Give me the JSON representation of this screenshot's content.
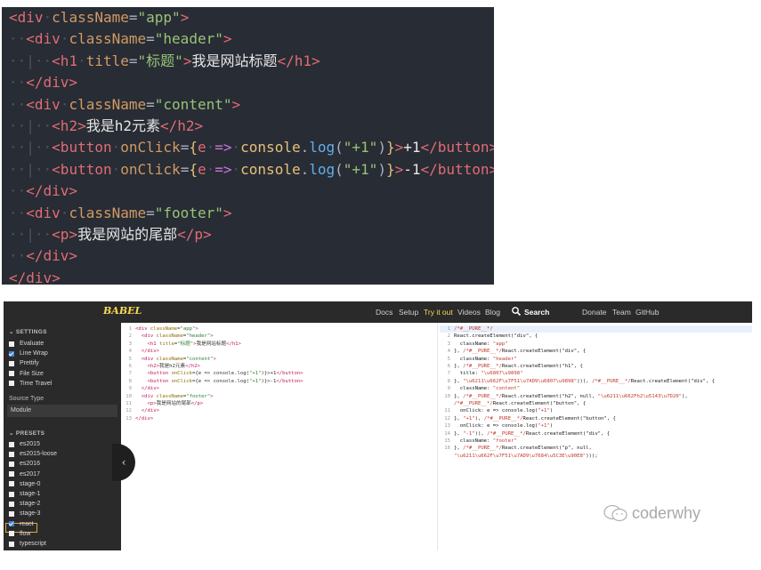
{
  "top_code": {
    "lines": [
      {
        "ind": "",
        "parts": [
          [
            "tag",
            "<div"
          ],
          [
            "ind",
            "·"
          ],
          [
            "attr",
            "className"
          ],
          [
            "punc",
            "="
          ],
          [
            "str",
            "\"app\""
          ],
          [
            "tag",
            ">"
          ]
        ]
      },
      {
        "ind": "··",
        "parts": [
          [
            "tag",
            "<div"
          ],
          [
            "ind",
            "·"
          ],
          [
            "attr",
            "className"
          ],
          [
            "punc",
            "="
          ],
          [
            "str",
            "\"header\""
          ],
          [
            "tag",
            ">"
          ]
        ]
      },
      {
        "ind": "··|··",
        "parts": [
          [
            "tag",
            "<h1"
          ],
          [
            "ind",
            "·"
          ],
          [
            "attr",
            "title"
          ],
          [
            "punc",
            "="
          ],
          [
            "str",
            "\"标题\""
          ],
          [
            "tag",
            ">"
          ],
          [
            "txt",
            "我是网站标题"
          ],
          [
            "tag",
            "</h1>"
          ]
        ]
      },
      {
        "ind": "··",
        "parts": [
          [
            "tag",
            "</div>"
          ]
        ]
      },
      {
        "ind": "··",
        "parts": [
          [
            "tag",
            "<div"
          ],
          [
            "ind",
            "·"
          ],
          [
            "attr",
            "className"
          ],
          [
            "punc",
            "="
          ],
          [
            "str",
            "\"content\""
          ],
          [
            "tag",
            ">"
          ]
        ]
      },
      {
        "ind": "··|··",
        "parts": [
          [
            "tag",
            "<h2"
          ],
          [
            "tag",
            ">"
          ],
          [
            "txt",
            "我是h2元素"
          ],
          [
            "tag",
            "</h2>"
          ]
        ]
      },
      {
        "ind": "··|··",
        "parts": [
          [
            "tag",
            "<button"
          ],
          [
            "ind",
            "·"
          ],
          [
            "attr",
            "onClick"
          ],
          [
            "punc",
            "="
          ],
          [
            "brace",
            "{"
          ],
          [
            "param",
            "e"
          ],
          [
            "ind",
            "·"
          ],
          [
            "arrow",
            "=>"
          ],
          [
            "ind",
            "·"
          ],
          [
            "ident",
            "console"
          ],
          [
            "punc",
            "."
          ],
          [
            "func",
            "log"
          ],
          [
            "punc",
            "("
          ],
          [
            "str",
            "\"+1\""
          ],
          [
            "punc",
            ")"
          ],
          [
            "brace",
            "}"
          ],
          [
            "tag",
            ">"
          ],
          [
            "txt",
            "+1"
          ],
          [
            "tag",
            "</button>"
          ]
        ]
      },
      {
        "ind": "··|··",
        "parts": [
          [
            "tag",
            "<button"
          ],
          [
            "ind",
            "·"
          ],
          [
            "attr",
            "onClick"
          ],
          [
            "punc",
            "="
          ],
          [
            "brace",
            "{"
          ],
          [
            "param",
            "e"
          ],
          [
            "ind",
            "·"
          ],
          [
            "arrow",
            "=>"
          ],
          [
            "ind",
            "·"
          ],
          [
            "ident",
            "console"
          ],
          [
            "punc",
            "."
          ],
          [
            "func",
            "log"
          ],
          [
            "punc",
            "("
          ],
          [
            "str",
            "\"+1\""
          ],
          [
            "punc",
            ")"
          ],
          [
            "brace",
            "}"
          ],
          [
            "tag",
            ">"
          ],
          [
            "txt",
            "-1"
          ],
          [
            "tag",
            "</button>"
          ]
        ]
      },
      {
        "ind": "··",
        "parts": [
          [
            "tag",
            "</div>"
          ]
        ]
      },
      {
        "ind": "··",
        "parts": [
          [
            "tag",
            "<div"
          ],
          [
            "ind",
            "·"
          ],
          [
            "attr",
            "className"
          ],
          [
            "punc",
            "="
          ],
          [
            "str",
            "\"footer\""
          ],
          [
            "tag",
            ">"
          ]
        ]
      },
      {
        "ind": "··|··",
        "parts": [
          [
            "tag",
            "<p"
          ],
          [
            "tag",
            ">"
          ],
          [
            "txt",
            "我是网站的尾部"
          ],
          [
            "tag",
            "</p>"
          ]
        ]
      },
      {
        "ind": "··",
        "parts": [
          [
            "tag",
            "</div>"
          ]
        ]
      },
      {
        "ind": "",
        "parts": [
          [
            "tag",
            "</div>"
          ]
        ]
      }
    ]
  },
  "babel": {
    "logo": "BABEL",
    "nav": [
      {
        "label": "Docs",
        "active": false
      },
      {
        "label": "Setup",
        "active": false
      },
      {
        "label": "Try it out",
        "active": true
      },
      {
        "label": "Videos",
        "active": false
      },
      {
        "label": "Blog",
        "active": false
      },
      {
        "label": "Search",
        "active": false,
        "bold": true
      },
      {
        "label": "Donate",
        "active": false
      },
      {
        "label": "Team",
        "active": false
      },
      {
        "label": "GitHub",
        "active": false
      }
    ],
    "sidebar": {
      "settings_header": "SETTINGS",
      "settings": [
        {
          "label": "Evaluate",
          "checked": false
        },
        {
          "label": "Line Wrap",
          "checked": true
        },
        {
          "label": "Prettify",
          "checked": false
        },
        {
          "label": "File Size",
          "checked": false
        },
        {
          "label": "Time Travel",
          "checked": false
        }
      ],
      "source_type_label": "Source Type",
      "source_type_value": "Module",
      "presets_header": "PRESETS",
      "presets": [
        {
          "label": "es2015",
          "checked": false
        },
        {
          "label": "es2015-loose",
          "checked": false
        },
        {
          "label": "es2016",
          "checked": false
        },
        {
          "label": "es2017",
          "checked": false
        },
        {
          "label": "stage-0",
          "checked": false
        },
        {
          "label": "stage-1",
          "checked": false
        },
        {
          "label": "stage-2",
          "checked": false
        },
        {
          "label": "stage-3",
          "checked": false
        },
        {
          "label": "react",
          "checked": true
        },
        {
          "label": "flow",
          "checked": false
        },
        {
          "label": "typescript",
          "checked": false
        }
      ],
      "collapse_glyph": "‹"
    },
    "input_lines": [
      [
        [
          "b-tag",
          "<div "
        ],
        [
          "b-attr",
          "className"
        ],
        [
          "b-txt",
          "="
        ],
        [
          "b-str",
          "\"app\""
        ],
        [
          "b-tag",
          ">"
        ]
      ],
      [
        [
          "b-txt",
          "  "
        ],
        [
          "b-tag",
          "<div "
        ],
        [
          "b-attr",
          "className"
        ],
        [
          "b-txt",
          "="
        ],
        [
          "b-str",
          "\"header\""
        ],
        [
          "b-tag",
          ">"
        ]
      ],
      [
        [
          "b-txt",
          "    "
        ],
        [
          "b-tag",
          "<h1 "
        ],
        [
          "b-attr",
          "title"
        ],
        [
          "b-txt",
          "="
        ],
        [
          "b-str",
          "\"标题\""
        ],
        [
          "b-tag",
          ">"
        ],
        [
          "b-txt",
          "我是网站标题"
        ],
        [
          "b-tag",
          "</h1>"
        ]
      ],
      [
        [
          "b-txt",
          "  "
        ],
        [
          "b-tag",
          "</div>"
        ]
      ],
      [
        [
          "b-txt",
          "  "
        ],
        [
          "b-tag",
          "<div "
        ],
        [
          "b-attr",
          "className"
        ],
        [
          "b-txt",
          "="
        ],
        [
          "b-str",
          "\"content\""
        ],
        [
          "b-tag",
          ">"
        ]
      ],
      [
        [
          "b-txt",
          "    "
        ],
        [
          "b-tag",
          "<h2>"
        ],
        [
          "b-txt",
          "我是h2元素"
        ],
        [
          "b-tag",
          "</h2>"
        ]
      ],
      [
        [
          "b-txt",
          "    "
        ],
        [
          "b-tag",
          "<button "
        ],
        [
          "b-attr",
          "onClick"
        ],
        [
          "b-txt",
          "={e => console.log("
        ],
        [
          "b-str",
          "\"+1\""
        ],
        [
          "b-txt",
          ")}>+1"
        ],
        [
          "b-tag",
          "</button>"
        ]
      ],
      [
        [
          "b-txt",
          "    "
        ],
        [
          "b-tag",
          "<button "
        ],
        [
          "b-attr",
          "onClick"
        ],
        [
          "b-txt",
          "={e => console.log("
        ],
        [
          "b-str",
          "\"+1\""
        ],
        [
          "b-txt",
          ")}>-1"
        ],
        [
          "b-tag",
          "</button>"
        ]
      ],
      [
        [
          "b-txt",
          "  "
        ],
        [
          "b-tag",
          "</div>"
        ]
      ],
      [
        [
          "b-txt",
          "  "
        ],
        [
          "b-tag",
          "<div "
        ],
        [
          "b-attr",
          "className"
        ],
        [
          "b-txt",
          "="
        ],
        [
          "b-str",
          "\"footer\""
        ],
        [
          "b-tag",
          ">"
        ]
      ],
      [
        [
          "b-txt",
          "    "
        ],
        [
          "b-tag",
          "<p>"
        ],
        [
          "b-txt",
          "我是网站的尾部"
        ],
        [
          "b-tag",
          "</p>"
        ]
      ],
      [
        [
          "b-txt",
          "  "
        ],
        [
          "b-tag",
          "</div>"
        ]
      ],
      [
        [
          "b-tag",
          "</div>"
        ]
      ]
    ],
    "output_lines": [
      [
        [
          "b-cmt",
          "/*#__PURE__*/"
        ]
      ],
      [
        [
          "b-kw",
          "React.createElement(\"div\", {"
        ]
      ],
      [
        [
          "b-kw",
          "  className: "
        ],
        [
          "b-strr",
          "\"app\""
        ]
      ],
      [
        [
          "b-kw",
          "}, "
        ],
        [
          "b-cmt",
          "/*#__PURE__*/"
        ],
        [
          "b-kw",
          "React.createElement(\"div\", {"
        ]
      ],
      [
        [
          "b-kw",
          "  className: "
        ],
        [
          "b-strr",
          "\"header\""
        ]
      ],
      [
        [
          "b-kw",
          "}, "
        ],
        [
          "b-cmt",
          "/*#__PURE__*/"
        ],
        [
          "b-kw",
          "React.createElement(\"h1\", {"
        ]
      ],
      [
        [
          "b-kw",
          "  title: "
        ],
        [
          "b-strr",
          "\"\\u6807\\u9898\""
        ]
      ],
      [
        [
          "b-kw",
          "}, "
        ],
        [
          "b-strr",
          "\"\\u6211\\u662F\\u7F51\\u7AD9\\u6807\\u9898\""
        ],
        [
          "b-kw",
          "))), "
        ],
        [
          "b-cmt",
          "/*#__PURE__*/"
        ],
        [
          "b-kw",
          "React.createElement(\"div\", {"
        ]
      ],
      [
        [
          "b-kw",
          "  className: "
        ],
        [
          "b-strr",
          "\"content\""
        ]
      ],
      [
        [
          "b-kw",
          "}, "
        ],
        [
          "b-cmt",
          "/*#__PURE__*/"
        ],
        [
          "b-kw",
          "React.createElement(\"h2\", null, "
        ],
        [
          "b-strr",
          "\"\\u6211\\u662Fh2\\u5143\\u7D20\""
        ],
        [
          "b-kw",
          "),"
        ]
      ],
      [
        [
          "b-cmt",
          "/*#__PURE__*/"
        ],
        [
          "b-kw",
          "React.createElement(\"button\", {"
        ]
      ],
      [
        [
          "b-kw",
          "  onClick: e => console.log("
        ],
        [
          "b-strr",
          "\"+1\""
        ],
        [
          "b-kw",
          ")"
        ]
      ],
      [
        [
          "b-kw",
          "}, "
        ],
        [
          "b-strr",
          "\"+1\""
        ],
        [
          "b-kw",
          "), "
        ],
        [
          "b-cmt",
          "/*#__PURE__*/"
        ],
        [
          "b-kw",
          "React.createElement(\"button\", {"
        ]
      ],
      [
        [
          "b-kw",
          "  onClick: e => console.log("
        ],
        [
          "b-strr",
          "\"+1\""
        ],
        [
          "b-kw",
          ")"
        ]
      ],
      [
        [
          "b-kw",
          "}, "
        ],
        [
          "b-strr",
          "\"-1\""
        ],
        [
          "b-kw",
          ")), "
        ],
        [
          "b-cmt",
          "/*#__PURE__*/"
        ],
        [
          "b-kw",
          "React.createElement(\"div\", {"
        ]
      ],
      [
        [
          "b-kw",
          "  className: "
        ],
        [
          "b-strr",
          "\"footer\""
        ]
      ],
      [
        [
          "b-kw",
          "}, "
        ],
        [
          "b-cmt",
          "/*#__PURE__*/"
        ],
        [
          "b-kw",
          "React.createElement(\"p\", null,"
        ]
      ],
      [
        [
          "b-strr",
          "\"\\u6211\\u662F\\u7F51\\u7AD9\\u7684\\u5C3E\\u90E8\""
        ],
        [
          "b-kw",
          ")));"
        ]
      ]
    ],
    "output_line_numbers": [
      "1",
      "2",
      "3",
      "4",
      "5",
      "6",
      "7",
      "8",
      "9",
      "10",
      "",
      "11",
      "12",
      "13",
      "14",
      "15",
      "16",
      ""
    ]
  },
  "watermark": {
    "text": "coderwhy",
    "icon": "wechat-icon"
  }
}
